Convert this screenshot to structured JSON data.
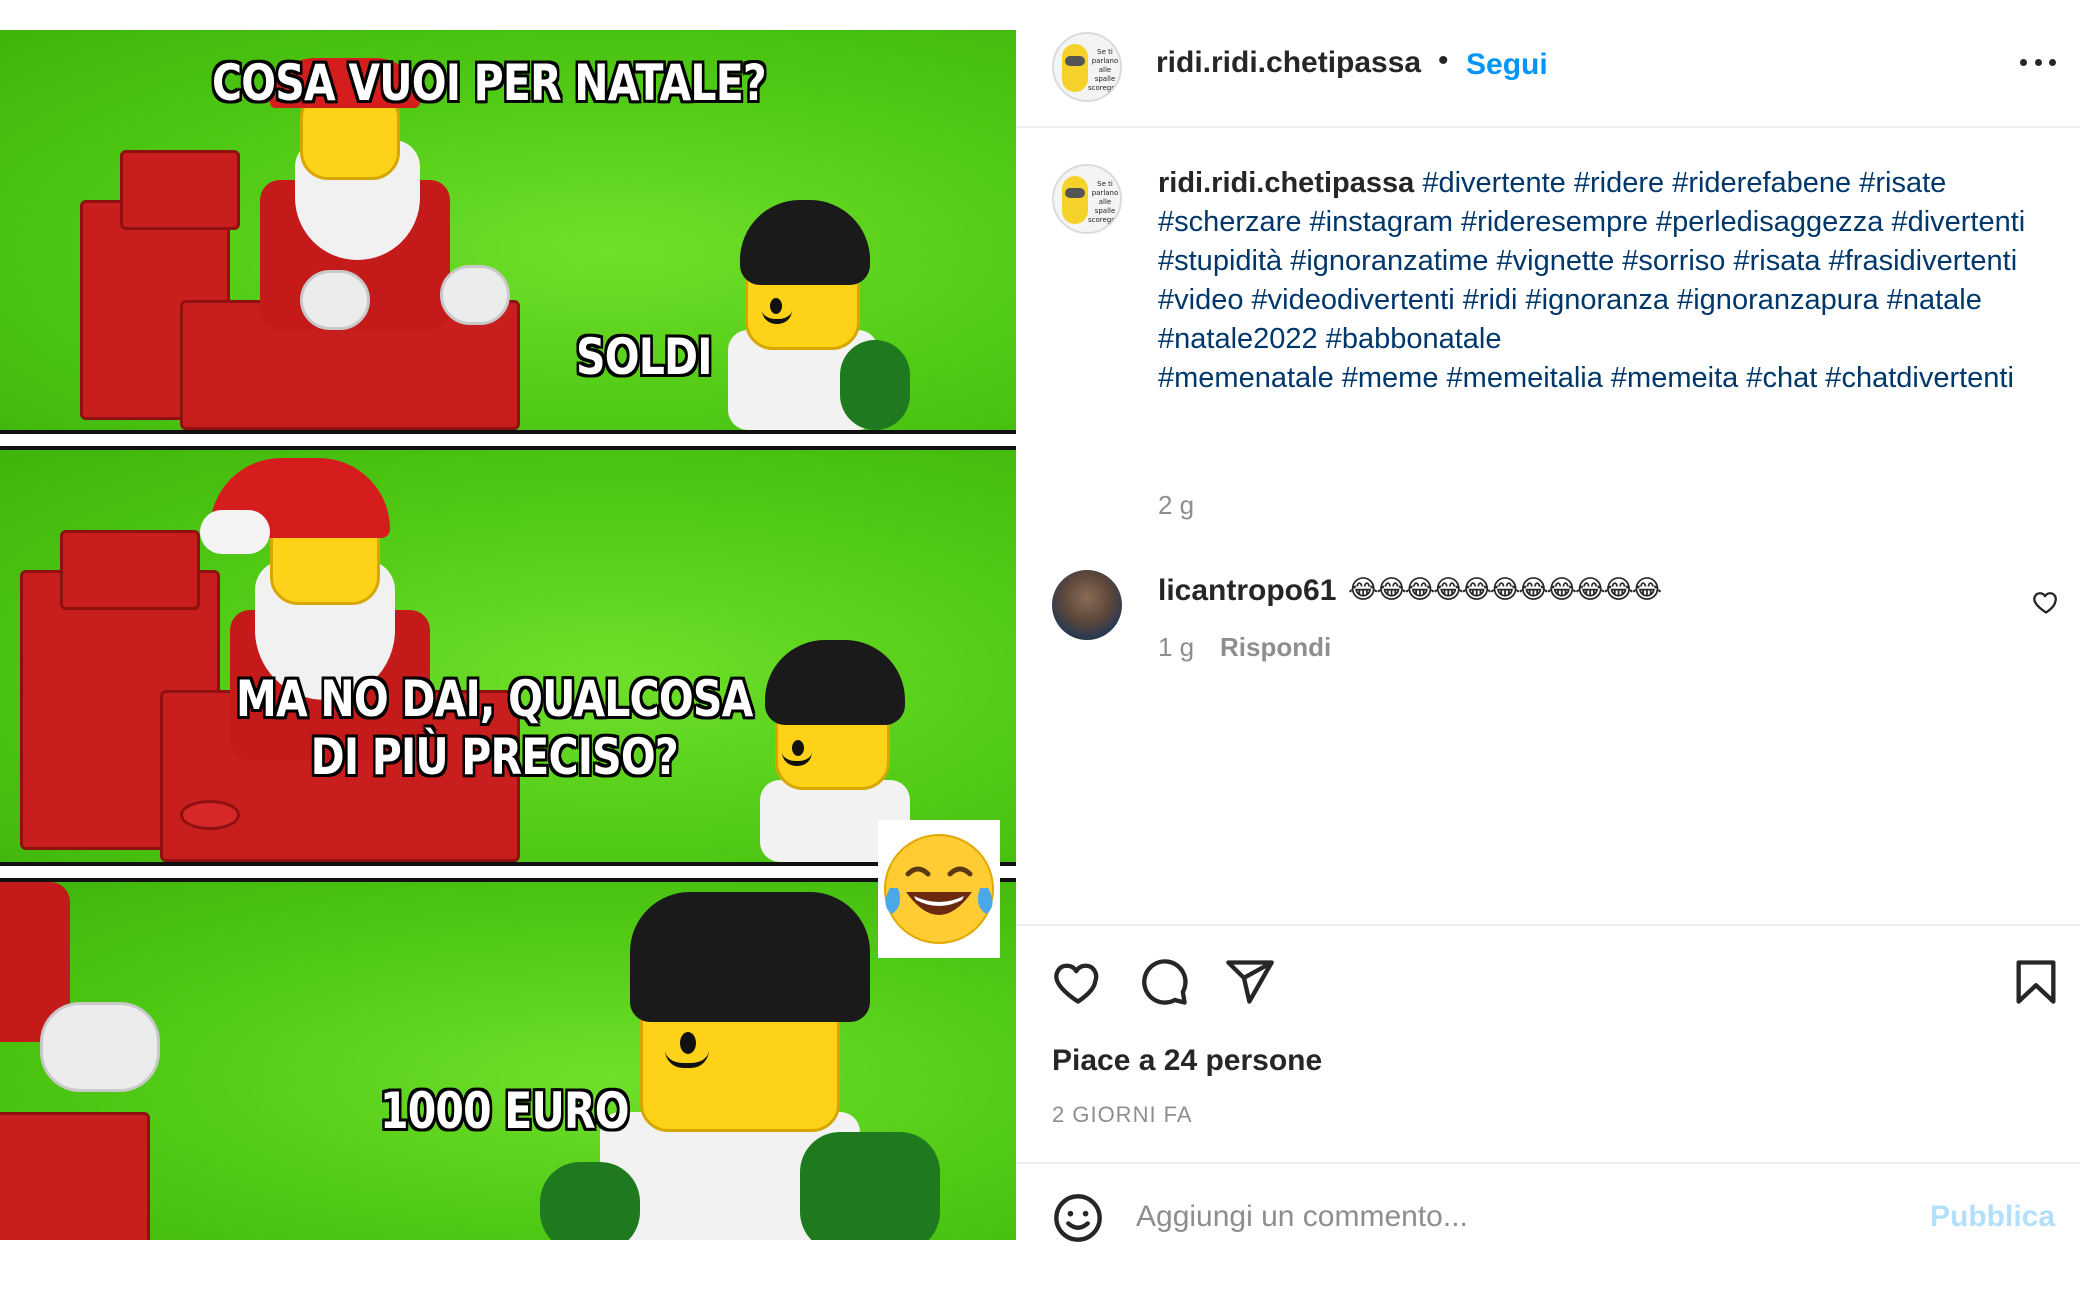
{
  "post": {
    "author": "ridi.ridi.chetipassa",
    "separator": "•",
    "follow_label": "Segui",
    "avatar_text": "Se ti parlano alle spalle scoreggia!"
  },
  "meme": {
    "caption_1": "COSA VUOI PER NATALE?",
    "caption_2": "SOLDI",
    "caption_3": "MA NO DAI, QUALCOSA\nDI PIÙ PRECISO?",
    "caption_4": "1000 EURO",
    "overlay_emoji": "😂"
  },
  "caption": {
    "username": "ridi.ridi.chetipassa",
    "hashtags_1": "#divertente #ridere #riderefabene #risate #scherzare #instagram #rideresempre #perledisaggezza #divertenti #stupidità #ignoranzatime #vignette #sorriso #risata #frasidivertenti #video #videodivertenti #ridi #ignoranza #ignoranzapura #natale #natale2022 #babbonatale",
    "hashtags_2": "#memenatale #meme #memeitalia #memeita #chat #chatdivertenti",
    "time": "2 g"
  },
  "comment": {
    "username": "licantropo61",
    "text": "😂😂😂😂😂😂😂😂😂😂😂",
    "time": "1 g",
    "reply_label": "Rispondi"
  },
  "actions": {
    "icons": [
      "heart-icon",
      "comment-icon",
      "share-icon",
      "bookmark-icon"
    ],
    "likes": "Piace a 24 persone",
    "date": "2 GIORNI FA"
  },
  "add_comment": {
    "placeholder": "Aggiungi un commento...",
    "publish_label": "Pubblica"
  },
  "colors": {
    "link": "#0095f6",
    "hashtag": "#00376b",
    "muted": "#8e8e8e",
    "publish_disabled": "#b2dffc",
    "meme_green": "#4fc914"
  }
}
